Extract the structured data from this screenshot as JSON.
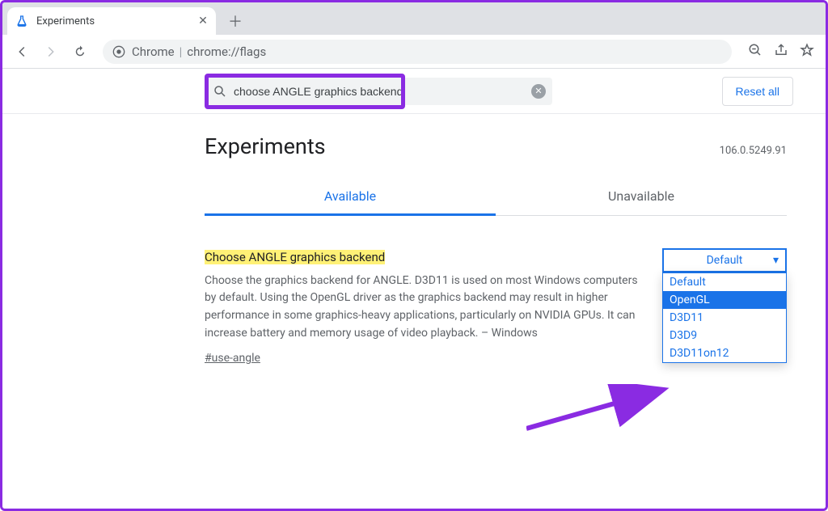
{
  "browser": {
    "tab_title": "Experiments",
    "omnibox_label": "Chrome",
    "omnibox_url": "chrome://flags"
  },
  "toolbar": {
    "reset_label": "Reset all"
  },
  "search": {
    "value": "choose ANGLE graphics backend"
  },
  "page": {
    "title": "Experiments",
    "version": "106.0.5249.91",
    "tabs": {
      "available": "Available",
      "unavailable": "Unavailable"
    }
  },
  "flag": {
    "title": "Choose ANGLE graphics backend",
    "description": "Choose the graphics backend for ANGLE. D3D11 is used on most Windows computers by default. Using the OpenGL driver as the graphics backend may result in higher performance in some graphics-heavy applications, particularly on NVIDIA GPUs. It can increase battery and memory usage of video playback. – Windows",
    "anchor": "#use-angle",
    "selected": "Default",
    "options": [
      "Default",
      "OpenGL",
      "D3D11",
      "D3D9",
      "D3D11on12"
    ],
    "highlighted_option": "OpenGL"
  }
}
